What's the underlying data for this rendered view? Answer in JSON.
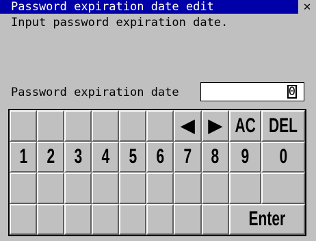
{
  "window": {
    "title": "Password expiration date edit",
    "close_glyph": "✕"
  },
  "message": "Input password expiration date.",
  "field": {
    "label": "Password expiration date",
    "value": "0"
  },
  "keypad": {
    "row1": [
      "",
      "",
      "",
      "",
      "",
      "",
      "◀",
      "▶",
      "AC",
      "DEL"
    ],
    "row2": [
      "1",
      "2",
      "3",
      "4",
      "5",
      "6",
      "7",
      "8",
      "9",
      "0"
    ],
    "row3": [
      "",
      "",
      "",
      "",
      "",
      "",
      "",
      "",
      "",
      ""
    ],
    "row4": [
      "",
      "",
      "",
      "",
      "",
      "",
      "",
      "",
      "Enter"
    ]
  },
  "colors": {
    "titlebar": "#0000a8",
    "background": "#c0c0c0",
    "field_bg": "#ffffff"
  }
}
